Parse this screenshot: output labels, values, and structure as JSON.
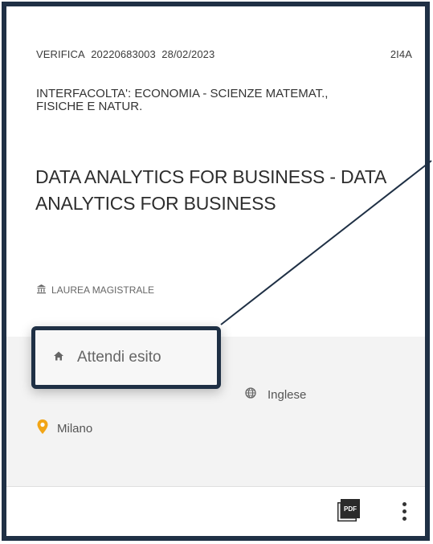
{
  "card": {
    "exam_type": "VERIFICA",
    "exam_code": "20220683003",
    "date": "28/02/2023",
    "course_code": "2I4A",
    "faculty": "INTERFACOLTA': ECONOMIA - SCIENZE MATEMAT., FISICHE E NATUR.",
    "title": "DATA ANALYTICS FOR BUSINESS - DATA ANALYTICS FOR BUSINESS",
    "degree": "LAUREA MAGISTRALE",
    "status": "Attendi esito",
    "language": "Inglese",
    "city": "Milano"
  },
  "icons": {
    "degree": "institution-icon",
    "status": "home-icon",
    "language": "globe-icon",
    "city": "location-pin-icon",
    "pdf": "pdf-icon",
    "more": "more-vertical-icon"
  },
  "colors": {
    "frame": "#1f3045",
    "pin": "#f2a516",
    "band": "#f3f3f3"
  }
}
